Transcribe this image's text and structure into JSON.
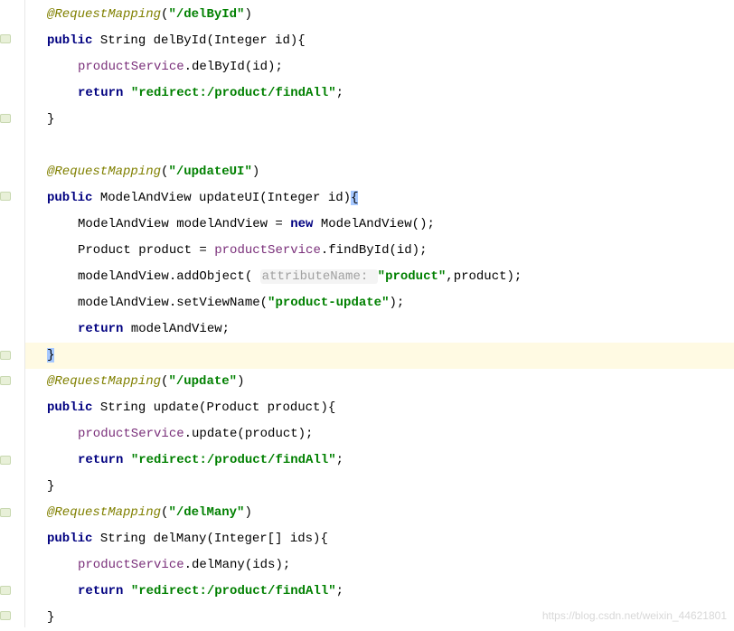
{
  "code": {
    "l1_ann": "@RequestMapping",
    "l1_paren_open": "(",
    "l1_str": "\"/delById\"",
    "l1_paren_close": ")",
    "l2_kw": "public",
    "l2_rest": " String delById(Integer id){",
    "l3_call": "productService",
    "l3_rest": ".delById(id);",
    "l4_kw": "return",
    "l4_sp": " ",
    "l4_str": "\"redirect:/product/findAll\"",
    "l4_semi": ";",
    "l5_brace": "}",
    "l6_empty": "",
    "l7_ann": "@RequestMapping",
    "l7_paren_open": "(",
    "l7_str": "\"/updateUI\"",
    "l7_paren_close": ")",
    "l8_kw": "public",
    "l8_rest": " ModelAndView updateUI(Integer id)",
    "l8_brace": "{",
    "l9a": "ModelAndView modelAndView = ",
    "l9_kw": "new",
    "l9b": " ModelAndView();",
    "l10a": "Product product = ",
    "l10_call": "productService",
    "l10b": ".findById(id);",
    "l11a": "modelAndView.addObject( ",
    "l11_hint": "attributeName: ",
    "l11_str": "\"product\"",
    "l11b": ",product);",
    "l12a": "modelAndView.setViewName(",
    "l12_str": "\"product-update\"",
    "l12b": ");",
    "l13_kw": "return",
    "l13_rest": " modelAndView;",
    "l14_brace": "}",
    "l15_ann": "@RequestMapping",
    "l15_paren_open": "(",
    "l15_str": "\"/update\"",
    "l15_paren_close": ")",
    "l16_kw": "public",
    "l16_rest": " String update(Product product){",
    "l17_call": "productService",
    "l17_rest": ".update(product);",
    "l18_kw": "return",
    "l18_sp": " ",
    "l18_str": "\"redirect:/product/findAll\"",
    "l18_semi": ";",
    "l19_brace": "}",
    "l20_ann": "@RequestMapping",
    "l20_paren_open": "(",
    "l20_str": "\"/delMany\"",
    "l20_paren_close": ")",
    "l21_kw": "public",
    "l21_rest": " String delMany(Integer[] ids){",
    "l22_call": "productService",
    "l22_rest": ".delMany(ids);",
    "l23_kw": "return",
    "l23_sp": " ",
    "l23_str": "\"redirect:/product/findAll\"",
    "l23_semi": ";",
    "l24_brace": "}"
  },
  "watermark": "https://blog.csdn.net/weixin_44621801"
}
